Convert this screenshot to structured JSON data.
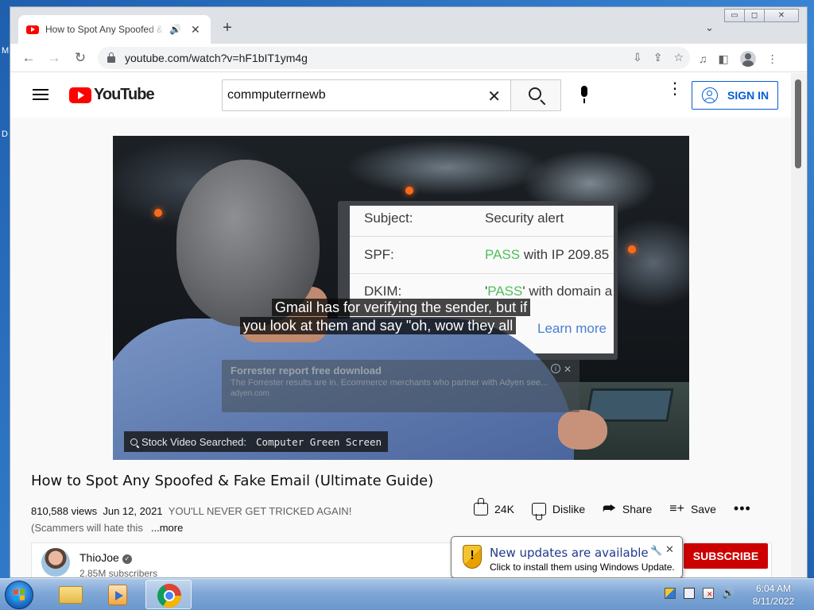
{
  "desktop": {
    "edge_text_top": "M",
    "edge_text_mid": "D"
  },
  "browser": {
    "tab": {
      "title": "How to Spot Any Spoofed & Fake Email (Ultimate Guide) - YouTube",
      "audio_icon": "🔊",
      "close_icon": "✕"
    },
    "new_tab_icon": "+",
    "tab_list_icon": "⌄",
    "window_controls": {
      "minimize": "▭",
      "maximize": "◻",
      "close": "✕"
    },
    "back_icon": "←",
    "forward_icon": "→",
    "reload_icon": "↻",
    "url": "youtube.com/watch?v=hF1bIT1ym4g",
    "omnibox_icons": {
      "install": "⇩",
      "share": "⇪",
      "bookmark": "☆"
    },
    "toolbar_icons": {
      "media": "♫",
      "sidepanel": "◧",
      "menu": "⋮"
    }
  },
  "youtube": {
    "logo_text": "YouTube",
    "search": {
      "value": "commputerrnewb",
      "clear_icon": "✕"
    },
    "more_icon": "⋮",
    "sign_in_label": "SIGN IN",
    "video": {
      "screen_rows": [
        {
          "label": "Subject:",
          "value": "Security alert",
          "pass": "",
          "rest": ""
        },
        {
          "label": "SPF:",
          "value": "",
          "pass": "PASS",
          "rest": " with IP 209.85"
        },
        {
          "label": "DKIM:",
          "value": "'",
          "pass": "PASS",
          "rest": "' with domain a"
        }
      ],
      "learn_more": "Learn more",
      "caption_line1": "Gmail has for verifying the sender, but if",
      "caption_line2": "you look at them and say \"oh, wow they all",
      "ad": {
        "title": "Forrester report free download",
        "description": "The Forrester results are in. Ecommerce merchants who partner with Adyen see...",
        "site": "adyen.com",
        "info_icon": "i",
        "close_icon": "✕"
      },
      "watermark_label": "Stock Video Searched:",
      "watermark_value": "Computer Green Screen"
    },
    "title": "How to Spot Any Spoofed & Fake Email (Ultimate Guide)",
    "views": "810,588 views",
    "date": "Jun 12, 2021",
    "description_line1": "YOU'LL NEVER GET TRICKED AGAIN!",
    "description_line2": "(Scammers will hate this",
    "more_label": "...more",
    "actions": {
      "likes": "24K",
      "dislike_label": "Dislike",
      "share_label": "Share",
      "save_label": "Save",
      "share_icon": "⮫",
      "save_icon": "≡+",
      "more_icon": "•••"
    },
    "channel": {
      "name": "ThioJoe",
      "verified_icon": "✓",
      "subscribers": "2.85M subscribers",
      "subscribe_label": "SUBSCRIBE"
    }
  },
  "balloon": {
    "title": "New updates are available",
    "text": "Click to install them using Windows Update.",
    "wrench_icon": "🔧",
    "close_icon": "✕"
  },
  "taskbar": {
    "volume_icon": "🔊",
    "clock_time": "6:04 AM",
    "clock_date": "8/11/2022"
  }
}
